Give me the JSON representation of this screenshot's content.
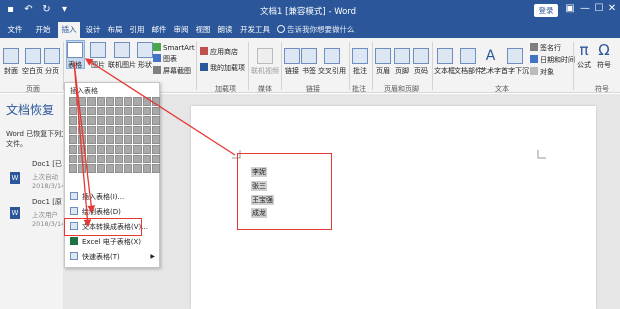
{
  "titlebar": {
    "doc_title": "文档1 [兼容模式] - Word",
    "login": "登录",
    "qat_icons": [
      "save-icon",
      "undo-icon",
      "redo-icon",
      "customize-icon"
    ],
    "controls": {
      "restore": "▣",
      "minimize": "—",
      "maximize": "☐",
      "close": "✕"
    }
  },
  "tabs": [
    "文件",
    "开始",
    "插入",
    "设计",
    "布局",
    "引用",
    "邮件",
    "审阅",
    "视图",
    "朗读",
    "开发工具"
  ],
  "active_tab": "插入",
  "tellme": "告诉我你想要做什么",
  "ribbon": {
    "pages": {
      "cover": "封面",
      "blank": "空白页",
      "break": "分页",
      "group": "页面"
    },
    "table": {
      "label": "表格",
      "group": "表格"
    },
    "illustrations": {
      "picture": "图片",
      "online_picture": "联机图片",
      "shapes": "形状",
      "smartart": "SmartArt",
      "chart": "图表",
      "screenshot": "屏幕截图"
    },
    "addins": {
      "store": "应用商店",
      "my_addins": "我的加载项",
      "group": "加载项"
    },
    "media": {
      "online_video": "联机视频",
      "group": "媒体"
    },
    "links": {
      "link": "链接",
      "bookmark": "书签",
      "crossref": "交叉引用",
      "group": "链接"
    },
    "comments": {
      "comment": "批注",
      "group": "批注"
    },
    "headerfooter": {
      "header": "页眉",
      "footer": "页脚",
      "page_number": "页码",
      "group": "页眉和页脚"
    },
    "text": {
      "textbox": "文本框",
      "quickparts": "文档部件",
      "wordart": "艺术字",
      "dropcap": "首字下沉",
      "signature": "签名行",
      "datetime": "日期和时间",
      "object": "对象",
      "group": "文本"
    },
    "symbols": {
      "equation": "公式",
      "symbol": "符号",
      "group": "符号"
    }
  },
  "pane": {
    "title": "文档恢复",
    "desc_line1": "Word 已恢复下列文",
    "desc_line2": "文件。",
    "items": [
      {
        "name": "Doc1 [已",
        "sub1": "上次自动",
        "sub2": "2018/3/14"
      },
      {
        "name": "Doc1 [原",
        "sub1": "上次用户",
        "sub2": "2018/3/14"
      }
    ]
  },
  "menu": {
    "header": "插入表格",
    "items": [
      {
        "label": "插入表格(I)...",
        "icon": "insert-table-icon"
      },
      {
        "label": "绘制表格(D)",
        "icon": "draw-table-icon"
      },
      {
        "label": "文本转换成表格(V)...",
        "icon": "convert-text-icon"
      },
      {
        "label": "Excel 电子表格(X)",
        "icon": "excel-icon"
      },
      {
        "label": "快速表格(T)",
        "icon": "quick-table-icon"
      }
    ]
  },
  "document": {
    "lines": [
      "李妮",
      "张三",
      "王宝强",
      "成龙"
    ]
  },
  "colors": {
    "brand": "#2b579a",
    "annotation": "#e53935"
  }
}
